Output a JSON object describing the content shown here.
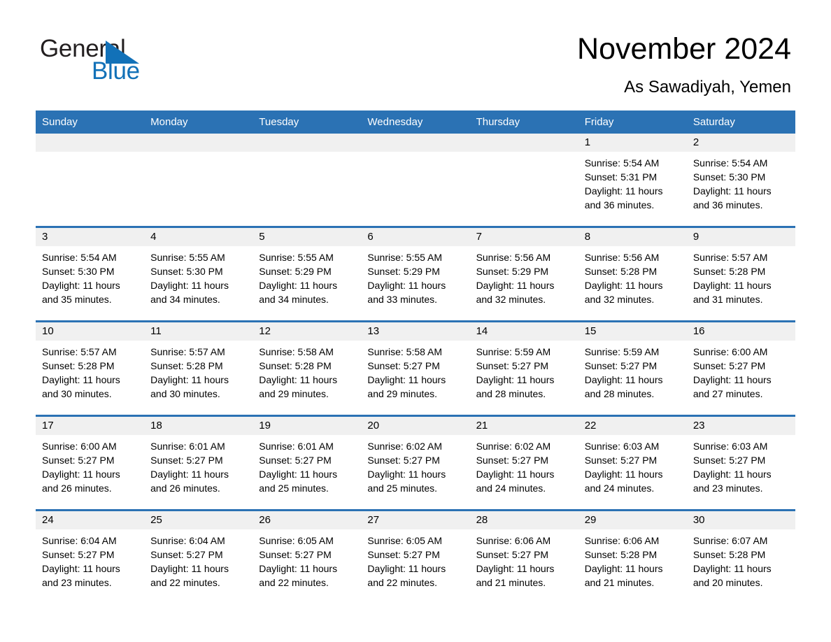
{
  "brand": {
    "name_part1": "General",
    "name_part2": "Blue",
    "flag_icon": "triangle-flag-icon",
    "accent_color": "#1271b8"
  },
  "header": {
    "month_title": "November 2024",
    "location": "As Sawadiyah, Yemen"
  },
  "calendar": {
    "header_bg": "#2b72b4",
    "daynum_bg": "#f0f0f0",
    "weekdays": [
      "Sunday",
      "Monday",
      "Tuesday",
      "Wednesday",
      "Thursday",
      "Friday",
      "Saturday"
    ],
    "weeks": [
      [
        {
          "day": ""
        },
        {
          "day": ""
        },
        {
          "day": ""
        },
        {
          "day": ""
        },
        {
          "day": ""
        },
        {
          "day": "1",
          "sunrise": "Sunrise: 5:54 AM",
          "sunset": "Sunset: 5:31 PM",
          "daylight": "Daylight: 11 hours and 36 minutes."
        },
        {
          "day": "2",
          "sunrise": "Sunrise: 5:54 AM",
          "sunset": "Sunset: 5:30 PM",
          "daylight": "Daylight: 11 hours and 36 minutes."
        }
      ],
      [
        {
          "day": "3",
          "sunrise": "Sunrise: 5:54 AM",
          "sunset": "Sunset: 5:30 PM",
          "daylight": "Daylight: 11 hours and 35 minutes."
        },
        {
          "day": "4",
          "sunrise": "Sunrise: 5:55 AM",
          "sunset": "Sunset: 5:30 PM",
          "daylight": "Daylight: 11 hours and 34 minutes."
        },
        {
          "day": "5",
          "sunrise": "Sunrise: 5:55 AM",
          "sunset": "Sunset: 5:29 PM",
          "daylight": "Daylight: 11 hours and 34 minutes."
        },
        {
          "day": "6",
          "sunrise": "Sunrise: 5:55 AM",
          "sunset": "Sunset: 5:29 PM",
          "daylight": "Daylight: 11 hours and 33 minutes."
        },
        {
          "day": "7",
          "sunrise": "Sunrise: 5:56 AM",
          "sunset": "Sunset: 5:29 PM",
          "daylight": "Daylight: 11 hours and 32 minutes."
        },
        {
          "day": "8",
          "sunrise": "Sunrise: 5:56 AM",
          "sunset": "Sunset: 5:28 PM",
          "daylight": "Daylight: 11 hours and 32 minutes."
        },
        {
          "day": "9",
          "sunrise": "Sunrise: 5:57 AM",
          "sunset": "Sunset: 5:28 PM",
          "daylight": "Daylight: 11 hours and 31 minutes."
        }
      ],
      [
        {
          "day": "10",
          "sunrise": "Sunrise: 5:57 AM",
          "sunset": "Sunset: 5:28 PM",
          "daylight": "Daylight: 11 hours and 30 minutes."
        },
        {
          "day": "11",
          "sunrise": "Sunrise: 5:57 AM",
          "sunset": "Sunset: 5:28 PM",
          "daylight": "Daylight: 11 hours and 30 minutes."
        },
        {
          "day": "12",
          "sunrise": "Sunrise: 5:58 AM",
          "sunset": "Sunset: 5:28 PM",
          "daylight": "Daylight: 11 hours and 29 minutes."
        },
        {
          "day": "13",
          "sunrise": "Sunrise: 5:58 AM",
          "sunset": "Sunset: 5:27 PM",
          "daylight": "Daylight: 11 hours and 29 minutes."
        },
        {
          "day": "14",
          "sunrise": "Sunrise: 5:59 AM",
          "sunset": "Sunset: 5:27 PM",
          "daylight": "Daylight: 11 hours and 28 minutes."
        },
        {
          "day": "15",
          "sunrise": "Sunrise: 5:59 AM",
          "sunset": "Sunset: 5:27 PM",
          "daylight": "Daylight: 11 hours and 28 minutes."
        },
        {
          "day": "16",
          "sunrise": "Sunrise: 6:00 AM",
          "sunset": "Sunset: 5:27 PM",
          "daylight": "Daylight: 11 hours and 27 minutes."
        }
      ],
      [
        {
          "day": "17",
          "sunrise": "Sunrise: 6:00 AM",
          "sunset": "Sunset: 5:27 PM",
          "daylight": "Daylight: 11 hours and 26 minutes."
        },
        {
          "day": "18",
          "sunrise": "Sunrise: 6:01 AM",
          "sunset": "Sunset: 5:27 PM",
          "daylight": "Daylight: 11 hours and 26 minutes."
        },
        {
          "day": "19",
          "sunrise": "Sunrise: 6:01 AM",
          "sunset": "Sunset: 5:27 PM",
          "daylight": "Daylight: 11 hours and 25 minutes."
        },
        {
          "day": "20",
          "sunrise": "Sunrise: 6:02 AM",
          "sunset": "Sunset: 5:27 PM",
          "daylight": "Daylight: 11 hours and 25 minutes."
        },
        {
          "day": "21",
          "sunrise": "Sunrise: 6:02 AM",
          "sunset": "Sunset: 5:27 PM",
          "daylight": "Daylight: 11 hours and 24 minutes."
        },
        {
          "day": "22",
          "sunrise": "Sunrise: 6:03 AM",
          "sunset": "Sunset: 5:27 PM",
          "daylight": "Daylight: 11 hours and 24 minutes."
        },
        {
          "day": "23",
          "sunrise": "Sunrise: 6:03 AM",
          "sunset": "Sunset: 5:27 PM",
          "daylight": "Daylight: 11 hours and 23 minutes."
        }
      ],
      [
        {
          "day": "24",
          "sunrise": "Sunrise: 6:04 AM",
          "sunset": "Sunset: 5:27 PM",
          "daylight": "Daylight: 11 hours and 23 minutes."
        },
        {
          "day": "25",
          "sunrise": "Sunrise: 6:04 AM",
          "sunset": "Sunset: 5:27 PM",
          "daylight": "Daylight: 11 hours and 22 minutes."
        },
        {
          "day": "26",
          "sunrise": "Sunrise: 6:05 AM",
          "sunset": "Sunset: 5:27 PM",
          "daylight": "Daylight: 11 hours and 22 minutes."
        },
        {
          "day": "27",
          "sunrise": "Sunrise: 6:05 AM",
          "sunset": "Sunset: 5:27 PM",
          "daylight": "Daylight: 11 hours and 22 minutes."
        },
        {
          "day": "28",
          "sunrise": "Sunrise: 6:06 AM",
          "sunset": "Sunset: 5:27 PM",
          "daylight": "Daylight: 11 hours and 21 minutes."
        },
        {
          "day": "29",
          "sunrise": "Sunrise: 6:06 AM",
          "sunset": "Sunset: 5:28 PM",
          "daylight": "Daylight: 11 hours and 21 minutes."
        },
        {
          "day": "30",
          "sunrise": "Sunrise: 6:07 AM",
          "sunset": "Sunset: 5:28 PM",
          "daylight": "Daylight: 11 hours and 20 minutes."
        }
      ]
    ]
  }
}
